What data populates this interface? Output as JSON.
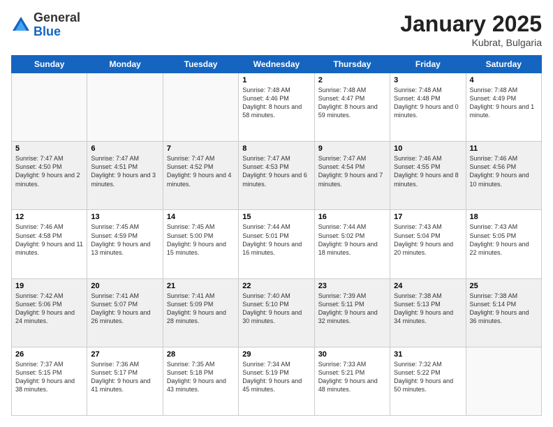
{
  "logo": {
    "general": "General",
    "blue": "Blue"
  },
  "header": {
    "month": "January 2025",
    "location": "Kubrat, Bulgaria"
  },
  "weekdays": [
    "Sunday",
    "Monday",
    "Tuesday",
    "Wednesday",
    "Thursday",
    "Friday",
    "Saturday"
  ],
  "weeks": [
    [
      {
        "day": "",
        "empty": true
      },
      {
        "day": "",
        "empty": true
      },
      {
        "day": "",
        "empty": true
      },
      {
        "day": "1",
        "sunrise": "7:48 AM",
        "sunset": "4:46 PM",
        "daylight": "8 hours and 58 minutes."
      },
      {
        "day": "2",
        "sunrise": "7:48 AM",
        "sunset": "4:47 PM",
        "daylight": "8 hours and 59 minutes."
      },
      {
        "day": "3",
        "sunrise": "7:48 AM",
        "sunset": "4:48 PM",
        "daylight": "9 hours and 0 minutes."
      },
      {
        "day": "4",
        "sunrise": "7:48 AM",
        "sunset": "4:49 PM",
        "daylight": "9 hours and 1 minute."
      }
    ],
    [
      {
        "day": "5",
        "sunrise": "7:47 AM",
        "sunset": "4:50 PM",
        "daylight": "9 hours and 2 minutes."
      },
      {
        "day": "6",
        "sunrise": "7:47 AM",
        "sunset": "4:51 PM",
        "daylight": "9 hours and 3 minutes."
      },
      {
        "day": "7",
        "sunrise": "7:47 AM",
        "sunset": "4:52 PM",
        "daylight": "9 hours and 4 minutes."
      },
      {
        "day": "8",
        "sunrise": "7:47 AM",
        "sunset": "4:53 PM",
        "daylight": "9 hours and 6 minutes."
      },
      {
        "day": "9",
        "sunrise": "7:47 AM",
        "sunset": "4:54 PM",
        "daylight": "9 hours and 7 minutes."
      },
      {
        "day": "10",
        "sunrise": "7:46 AM",
        "sunset": "4:55 PM",
        "daylight": "9 hours and 8 minutes."
      },
      {
        "day": "11",
        "sunrise": "7:46 AM",
        "sunset": "4:56 PM",
        "daylight": "9 hours and 10 minutes."
      }
    ],
    [
      {
        "day": "12",
        "sunrise": "7:46 AM",
        "sunset": "4:58 PM",
        "daylight": "9 hours and 11 minutes."
      },
      {
        "day": "13",
        "sunrise": "7:45 AM",
        "sunset": "4:59 PM",
        "daylight": "9 hours and 13 minutes."
      },
      {
        "day": "14",
        "sunrise": "7:45 AM",
        "sunset": "5:00 PM",
        "daylight": "9 hours and 15 minutes."
      },
      {
        "day": "15",
        "sunrise": "7:44 AM",
        "sunset": "5:01 PM",
        "daylight": "9 hours and 16 minutes."
      },
      {
        "day": "16",
        "sunrise": "7:44 AM",
        "sunset": "5:02 PM",
        "daylight": "9 hours and 18 minutes."
      },
      {
        "day": "17",
        "sunrise": "7:43 AM",
        "sunset": "5:04 PM",
        "daylight": "9 hours and 20 minutes."
      },
      {
        "day": "18",
        "sunrise": "7:43 AM",
        "sunset": "5:05 PM",
        "daylight": "9 hours and 22 minutes."
      }
    ],
    [
      {
        "day": "19",
        "sunrise": "7:42 AM",
        "sunset": "5:06 PM",
        "daylight": "9 hours and 24 minutes."
      },
      {
        "day": "20",
        "sunrise": "7:41 AM",
        "sunset": "5:07 PM",
        "daylight": "9 hours and 26 minutes."
      },
      {
        "day": "21",
        "sunrise": "7:41 AM",
        "sunset": "5:09 PM",
        "daylight": "9 hours and 28 minutes."
      },
      {
        "day": "22",
        "sunrise": "7:40 AM",
        "sunset": "5:10 PM",
        "daylight": "9 hours and 30 minutes."
      },
      {
        "day": "23",
        "sunrise": "7:39 AM",
        "sunset": "5:11 PM",
        "daylight": "9 hours and 32 minutes."
      },
      {
        "day": "24",
        "sunrise": "7:38 AM",
        "sunset": "5:13 PM",
        "daylight": "9 hours and 34 minutes."
      },
      {
        "day": "25",
        "sunrise": "7:38 AM",
        "sunset": "5:14 PM",
        "daylight": "9 hours and 36 minutes."
      }
    ],
    [
      {
        "day": "26",
        "sunrise": "7:37 AM",
        "sunset": "5:15 PM",
        "daylight": "9 hours and 38 minutes."
      },
      {
        "day": "27",
        "sunrise": "7:36 AM",
        "sunset": "5:17 PM",
        "daylight": "9 hours and 41 minutes."
      },
      {
        "day": "28",
        "sunrise": "7:35 AM",
        "sunset": "5:18 PM",
        "daylight": "9 hours and 43 minutes."
      },
      {
        "day": "29",
        "sunrise": "7:34 AM",
        "sunset": "5:19 PM",
        "daylight": "9 hours and 45 minutes."
      },
      {
        "day": "30",
        "sunrise": "7:33 AM",
        "sunset": "5:21 PM",
        "daylight": "9 hours and 48 minutes."
      },
      {
        "day": "31",
        "sunrise": "7:32 AM",
        "sunset": "5:22 PM",
        "daylight": "9 hours and 50 minutes."
      },
      {
        "day": "",
        "empty": true
      }
    ]
  ]
}
